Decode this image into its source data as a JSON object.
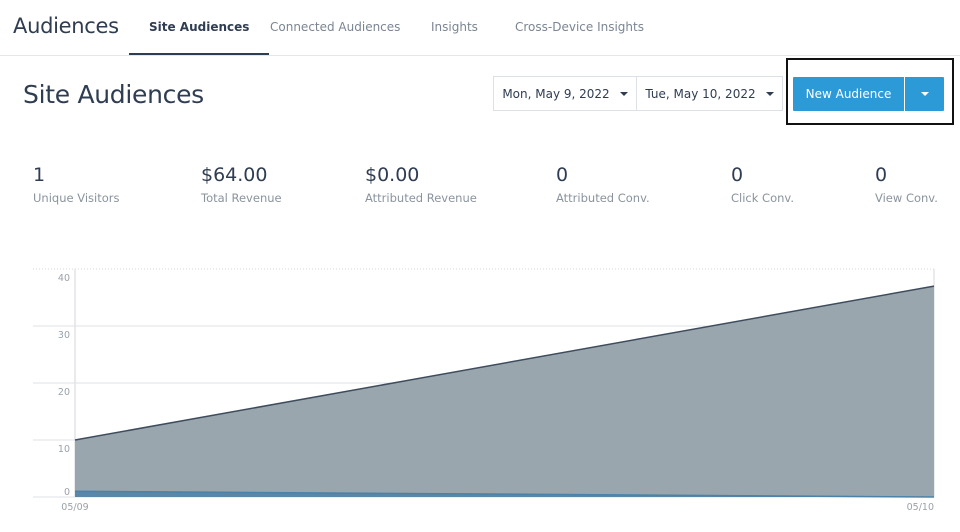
{
  "header": {
    "app_title": "Audiences",
    "tabs": [
      {
        "label": "Site Audiences",
        "active": true
      },
      {
        "label": "Connected Audiences",
        "active": false
      },
      {
        "label": "Insights",
        "active": false
      },
      {
        "label": "Cross-Device Insights",
        "active": false
      }
    ]
  },
  "page": {
    "title": "Site Audiences",
    "start_date": "Mon, May 9, 2022",
    "end_date": "Tue, May 10, 2022",
    "new_audience_label": "New Audience",
    "accent_color": "#2d9ad8"
  },
  "stats": [
    {
      "value": "1",
      "label": "Unique Visitors"
    },
    {
      "value": "$64.00",
      "label": "Total Revenue"
    },
    {
      "value": "$0.00",
      "label": "Attributed Revenue"
    },
    {
      "value": "0",
      "label": "Attributed Conv."
    },
    {
      "value": "0",
      "label": "Click Conv."
    },
    {
      "value": "0",
      "label": "View Conv."
    }
  ],
  "chart_data": {
    "type": "area",
    "x": [
      "05/09",
      "05/10"
    ],
    "series": [
      {
        "name": "upper",
        "values": [
          10,
          37
        ],
        "color": "#9aa6ae",
        "line_color": "#3e4c5e"
      },
      {
        "name": "lower",
        "values": [
          1,
          0
        ],
        "color": "#5a87a8",
        "line_color": "#4a82a8"
      }
    ],
    "yticks": [
      "0",
      "10",
      "20",
      "30",
      "40"
    ],
    "ylim": [
      0,
      40
    ],
    "grid": true
  }
}
